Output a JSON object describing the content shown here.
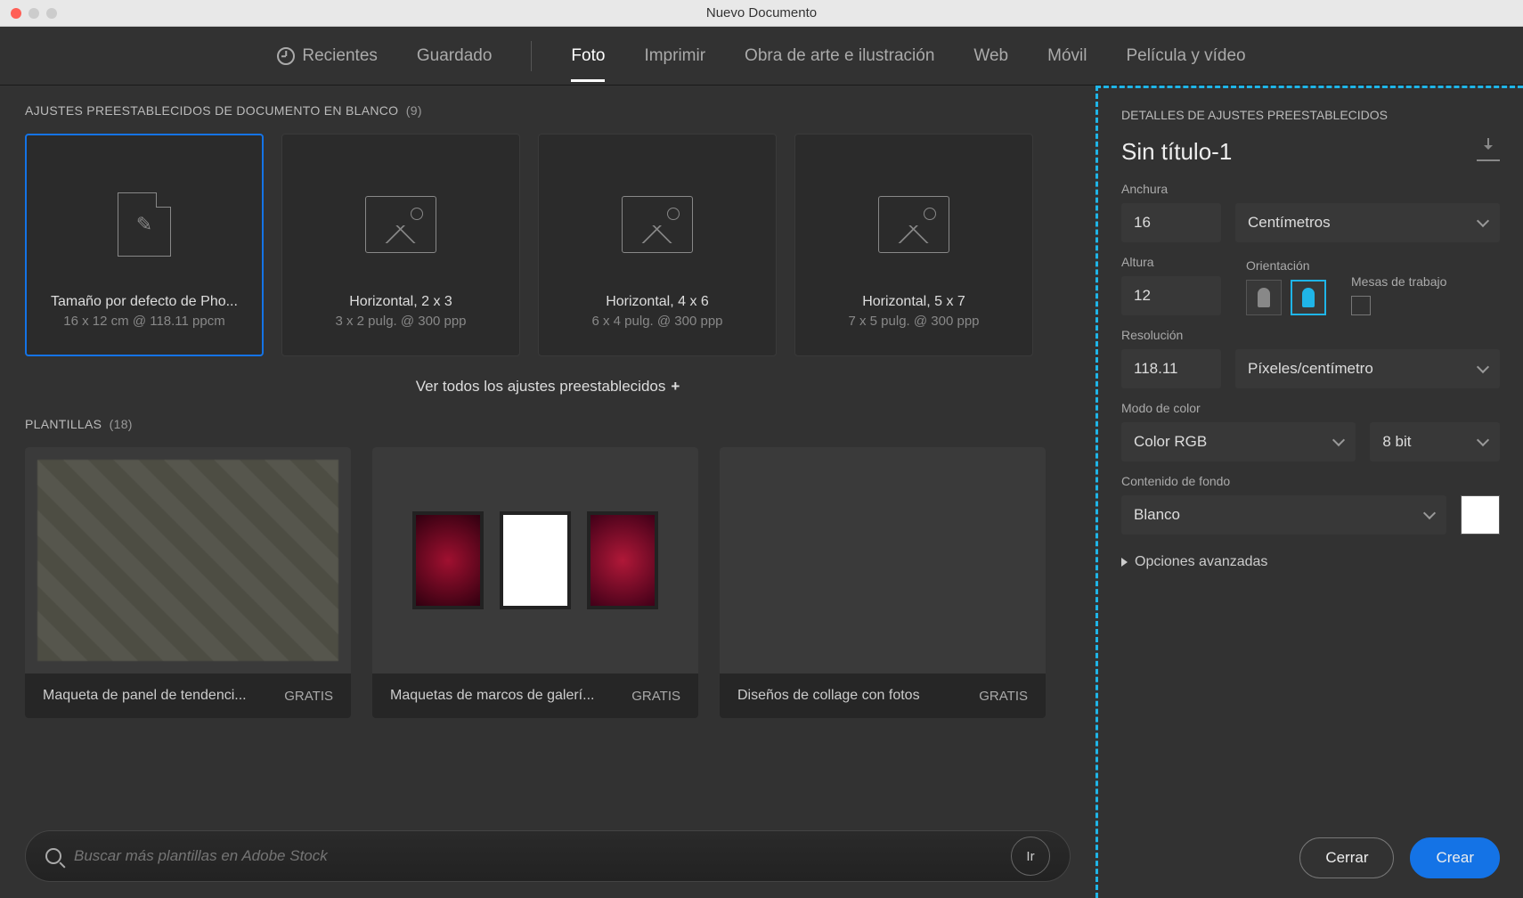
{
  "window": {
    "title": "Nuevo Documento"
  },
  "tabs": {
    "recent": "Recientes",
    "saved": "Guardado",
    "photo": "Foto",
    "print": "Imprimir",
    "art": "Obra de arte e ilustración",
    "web": "Web",
    "mobile": "Móvil",
    "film": "Película y vídeo"
  },
  "presets_section": {
    "title": "AJUSTES PREESTABLECIDOS DE DOCUMENTO EN BLANCO",
    "count": "(9)"
  },
  "presets": [
    {
      "name": "Tamaño por defecto de Pho...",
      "dim": "16 x 12 cm @ 118.11 ppcm"
    },
    {
      "name": "Horizontal, 2 x 3",
      "dim": "3 x 2 pulg. @ 300 ppp"
    },
    {
      "name": "Horizontal, 4 x 6",
      "dim": "6 x 4 pulg. @ 300 ppp"
    },
    {
      "name": "Horizontal, 5 x 7",
      "dim": "7 x 5 pulg. @ 300 ppp"
    }
  ],
  "view_all": "Ver todos los ajustes preestablecidos",
  "templates_section": {
    "title": "PLANTILLAS",
    "count": "(18)"
  },
  "templates": [
    {
      "name": "Maqueta de panel de tendenci...",
      "price": "GRATIS"
    },
    {
      "name": "Maquetas de marcos de galerí...",
      "price": "GRATIS"
    },
    {
      "name": "Diseños de collage con fotos",
      "price": "GRATIS"
    }
  ],
  "search": {
    "placeholder": "Buscar más plantillas en Adobe Stock",
    "go": "Ir"
  },
  "panel": {
    "title": "DETALLES DE AJUSTES PREESTABLECIDOS",
    "docname": "Sin título-1",
    "width_label": "Anchura",
    "width_value": "16",
    "units": "Centímetros",
    "height_label": "Altura",
    "height_value": "12",
    "orientation_label": "Orientación",
    "artboards_label": "Mesas de trabajo",
    "resolution_label": "Resolución",
    "resolution_value": "118.11",
    "resolution_units": "Píxeles/centímetro",
    "colormode_label": "Modo de color",
    "colormode": "Color RGB",
    "bitdepth": "8 bit",
    "bg_label": "Contenido de fondo",
    "bg_value": "Blanco",
    "advanced": "Opciones avanzadas"
  },
  "buttons": {
    "close": "Cerrar",
    "create": "Crear"
  }
}
